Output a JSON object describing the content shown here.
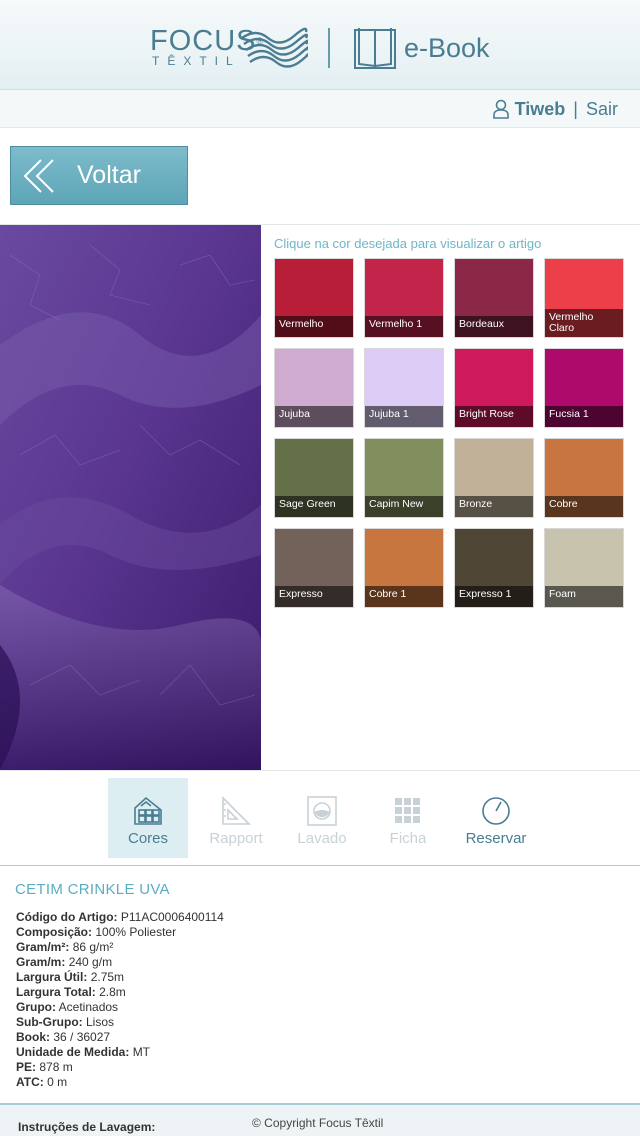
{
  "header": {
    "brand_name": "FOCUS",
    "brand_reg": "®",
    "brand_sub": "TÊXTIL",
    "ebook_title": "e-Book"
  },
  "user": {
    "name": "Tiweb",
    "separator": "|",
    "logout": "Sair"
  },
  "back_button": {
    "label": "Voltar"
  },
  "swatches": {
    "title": "Clique na cor desejada para visualizar o artigo",
    "items": [
      {
        "label": "Vermelho",
        "color": "#b81e37"
      },
      {
        "label": "Vermelho 1",
        "color": "#c2244a"
      },
      {
        "label": "Bordeaux",
        "color": "#8b2848"
      },
      {
        "label": "Vermelho Claro",
        "color": "#ed3f4a"
      },
      {
        "label": "Jujuba",
        "color": "#cfabcf"
      },
      {
        "label": "Jujuba 1",
        "color": "#dccbf4"
      },
      {
        "label": "Bright Rose",
        "color": "#ce1a5c"
      },
      {
        "label": "Fucsia 1",
        "color": "#ae0a6c"
      },
      {
        "label": "Sage Green",
        "color": "#647148"
      },
      {
        "label": "Capim New",
        "color": "#818e5e"
      },
      {
        "label": "Bronze",
        "color": "#c1b199"
      },
      {
        "label": "Cobre",
        "color": "#c87541"
      },
      {
        "label": "Expresso",
        "color": "#73625a"
      },
      {
        "label": "Cobre 1",
        "color": "#c8763f"
      },
      {
        "label": "Expresso 1",
        "color": "#4f4636"
      },
      {
        "label": "Foam",
        "color": "#c8c3ad"
      }
    ]
  },
  "tabs": [
    {
      "label": "Cores",
      "icon": "palette-grid-icon",
      "state": "active"
    },
    {
      "label": "Rapport",
      "icon": "set-square-icon",
      "state": "disabled"
    },
    {
      "label": "Lavado",
      "icon": "wash-icon",
      "state": "disabled"
    },
    {
      "label": "Ficha",
      "icon": "sheet-grid-icon",
      "state": "disabled"
    },
    {
      "label": "Reservar",
      "icon": "clock-icon",
      "state": "enabled"
    }
  ],
  "product": {
    "title": "CETIM CRINKLE UVA",
    "specs": [
      {
        "key": "Código do Artigo:",
        "value": "P11AC0006400114"
      },
      {
        "key": "Composição:",
        "value": "100% Poliester"
      },
      {
        "key": "Gram/m²:",
        "value": "86 g/m²"
      },
      {
        "key": "Gram/m:",
        "value": "240 g/m"
      },
      {
        "key": "Largura Útil:",
        "value": "2.75m"
      },
      {
        "key": "Largura Total:",
        "value": "2.8m"
      },
      {
        "key": "Grupo:",
        "value": "Acetinados"
      },
      {
        "key": "Sub-Grupo:",
        "value": "Lisos"
      },
      {
        "key": "Book:",
        "value": "36 / 36027"
      },
      {
        "key": "Unidade de Medida:",
        "value": "MT"
      },
      {
        "key": "PE:",
        "value": "878 m"
      },
      {
        "key": "ATC:",
        "value": "0 m"
      }
    ]
  },
  "footer": {
    "wash_label": "Instruções de Lavagem:",
    "copyright": "© Copyright Focus Têxtil"
  }
}
